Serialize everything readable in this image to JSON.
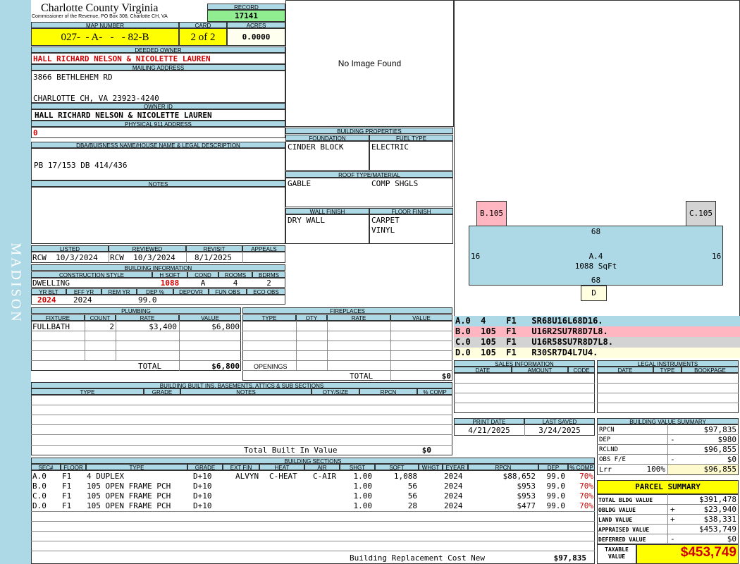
{
  "sidebar_label": "MADISON",
  "header": {
    "county": "Charlotte County Virginia",
    "commissioner": "Commissioner of the Revenue, PO Box 308, Charlotte CH, VA",
    "record_label": "RECORD",
    "record": "17141",
    "map_label": "MAP NUMBER",
    "map": "027-  - A-   -   - 82-B",
    "card_label": "CARD",
    "card": "2 of 2",
    "acres_label": "ACRES",
    "acres": "0.0000"
  },
  "owner": {
    "deeded_label": "DEEDED OWNER",
    "deeded": "HALL RICHARD NELSON & NICOLETTE LAUREN",
    "mailing_label": "MAILING ADDRESS",
    "addr1": "3866 BETHLEHEM RD",
    "addr2": "CHARLOTTE CH, VA 23923-4240",
    "owner_id_label": "OWNER ID",
    "owner_id": "HALL RICHARD NELSON & NICOLETTE LAUREN",
    "physical_label": "PHYSICAL 911 ADDRESS",
    "physical": "0",
    "dba_label": "DBA/BUISNESS NAME/HOUSE NAME & LEGAL DESCRIPTION",
    "dba": "PB 17/153 DB 414/436",
    "notes_label": "NOTES"
  },
  "image_text": "No Image Found",
  "building_props": {
    "title": "BUILDING PROPERTIES",
    "foundation_label": "FOUNDATION",
    "foundation": "CINDER BLOCK",
    "fuel_label": "FUEL TYPE",
    "fuel": "ELECTRIC",
    "roof_label": "ROOF TYPE/MATERIAL",
    "roof_type": "GABLE",
    "roof_mat": "COMP SHGLS",
    "wall_label": "WALL FINISH",
    "wall": "DRY WALL",
    "floor_label": "FLOOR FINISH",
    "floor1": "CARPET",
    "floor2": "VINYL"
  },
  "review": {
    "listed_label": "LISTED",
    "listed": "RCW  10/3/2024",
    "reviewed_label": "REVIEWED",
    "reviewed": "RCW  10/3/2024",
    "revisit_label": "REVISIT",
    "revisit": "8/1/2025",
    "appeals_label": "APPEALS",
    "appeals": ""
  },
  "building_info": {
    "title": "BUILDING INFORMATION",
    "style_label": "CONSTRUCTION STYLE",
    "style": "DWELLING",
    "hsqft_label": "H SQFT",
    "hsqft": "1088",
    "cond_label": "COND",
    "cond": "A",
    "rooms_label": "ROOMS",
    "rooms": "4",
    "bdrms_label": "BDRMS",
    "bdrms": "2",
    "yrblt_label": "YR BLT",
    "yrblt": "2024",
    "effyr_label": "EFF YR",
    "effyr": "2024",
    "remyr_label": "REM YR",
    "remyr": "",
    "dep_label": "DEP %",
    "dep": "99.0",
    "depovr_label": "DEPOVR",
    "depovr": "",
    "funobs_label": "FUN OBS",
    "funobs": "",
    "ecoobs_label": "ECO OBS",
    "ecoobs": ""
  },
  "plumbing": {
    "title": "PLUMBING",
    "cols": [
      "FIXTURE",
      "COUNT",
      "RATE",
      "VALUE"
    ],
    "rows": [
      {
        "fixture": "FULLBATH",
        "count": "2",
        "rate": "$3,400",
        "value": "$6,800"
      }
    ],
    "total_label": "TOTAL",
    "total": "$6,800"
  },
  "fireplaces": {
    "title": "FIREPLACES",
    "cols": [
      "TYPE",
      "QTY",
      "RATE",
      "VALUE"
    ],
    "openings_label": "OPENINGS",
    "total_label": "TOTAL",
    "total": "$0"
  },
  "builtins": {
    "title": "BUILDING BUILT INS, BASEMENTS, ATTICS & SUB SECTIONS",
    "cols": [
      "TYPE",
      "GRADE",
      "NOTES",
      "QTY/SIZE",
      "RPCN",
      "% COMP"
    ],
    "total_label": "Total Built In Value",
    "total": "$0"
  },
  "sections": {
    "title": "BUILDING SECTIONS",
    "cols": [
      "SEC#",
      "FLOOR",
      "TYPE",
      "GRADE",
      "EXT FIN",
      "HEAT",
      "AIR",
      "SHGT",
      "SQFT",
      "WHGT",
      "EYEAR",
      "RPCN",
      "DEP",
      "% COMP"
    ],
    "rows": [
      {
        "sec": "A.0",
        "floor": "F1",
        "type": "4 DUPLEX",
        "grade": "D+10",
        "extfin": "ALVYN",
        "heat": "C-HEAT",
        "air": "C-AIR",
        "shgt": "1.00",
        "sqft": "1,088",
        "whgt": "",
        "eyear": "2024",
        "rpcn": "$88,652",
        "dep": "99.0",
        "comp": "70%"
      },
      {
        "sec": "B.0",
        "floor": "F1",
        "type": "105 OPEN FRAME PCH",
        "grade": "D+10",
        "extfin": "",
        "heat": "",
        "air": "",
        "shgt": "1.00",
        "sqft": "56",
        "whgt": "",
        "eyear": "2024",
        "rpcn": "$953",
        "dep": "99.0",
        "comp": "70%"
      },
      {
        "sec": "C.0",
        "floor": "F1",
        "type": "105 OPEN FRAME PCH",
        "grade": "D+10",
        "extfin": "",
        "heat": "",
        "air": "",
        "shgt": "1.00",
        "sqft": "56",
        "whgt": "",
        "eyear": "2024",
        "rpcn": "$953",
        "dep": "99.0",
        "comp": "70%"
      },
      {
        "sec": "D.0",
        "floor": "F1",
        "type": "105 OPEN FRAME PCH",
        "grade": "D+10",
        "extfin": "",
        "heat": "",
        "air": "",
        "shgt": "1.00",
        "sqft": "28",
        "whgt": "",
        "eyear": "2024",
        "rpcn": "$477",
        "dep": "99.0",
        "comp": "70%"
      }
    ],
    "replacement_label": "Building Replacement Cost New",
    "replacement": "$97,835"
  },
  "sketch": {
    "b_label": "B.105",
    "c_label": "C.105",
    "top": "68",
    "bottom": "68",
    "left": "16",
    "right": "16",
    "main_label": "A.4",
    "main_sqft": "1088 SqFt",
    "d_label": "D",
    "legend": [
      {
        "text": "A.0  4    F1   SR68U16L68D16.",
        "color": "#add8e6"
      },
      {
        "text": "B.0  105  F1   U16R2SU7R8D7L8.",
        "color": "#ffb6c1"
      },
      {
        "text": "C.0  105  F1   U16R58SU7R8D7L8.",
        "color": "#d3d3d3"
      },
      {
        "text": "D.0  105  F1   R30SR7D4L7U4.",
        "color": "#ffffe0"
      }
    ]
  },
  "sales": {
    "title": "SALES INFORMATION",
    "cols": [
      "DATE",
      "AMOUNT",
      "CODE"
    ]
  },
  "legal": {
    "title": "LEGAL INSTRUMENTS",
    "cols": [
      "DATE",
      "TYPE",
      "BOOKPAGE"
    ]
  },
  "dates": {
    "print_label": "PRINT DATE",
    "print": "4/21/2025",
    "saved_label": "LAST SAVED",
    "saved": "3/24/2025"
  },
  "bvs": {
    "title": "BUILDING VALUE SUMMARY",
    "rpcn_label": "RPCN",
    "rpcn": "$97,835",
    "dep_label": "DEP",
    "dep_sign": "-",
    "dep": "$980",
    "rclnd_label": "RCLND",
    "rclnd": "$96,855",
    "obs_label": "OBS F/E",
    "obs_sign": "-",
    "obs": "$0",
    "lrr_label": "Lrr",
    "lrr_pct": "100%",
    "lrr": "$96,855"
  },
  "parcel": {
    "title": "PARCEL SUMMARY",
    "bldg_label": "TOTAL BLDG VALUE",
    "bldg": "$391,478",
    "obldg_label": "OBLDG VALUE",
    "obldg_sign": "+",
    "obldg": "$23,940",
    "land_label": "LAND VALUE",
    "land_sign": "+",
    "land": "$38,331",
    "appraised_label": "APPRAISED VALUE",
    "appraised": "$453,749",
    "deferred_label": "DEFERRED VALUE",
    "deferred_sign": "-",
    "deferred": "$0",
    "taxable_label": "TAXABLE VALUE",
    "taxable": "$453,749"
  }
}
